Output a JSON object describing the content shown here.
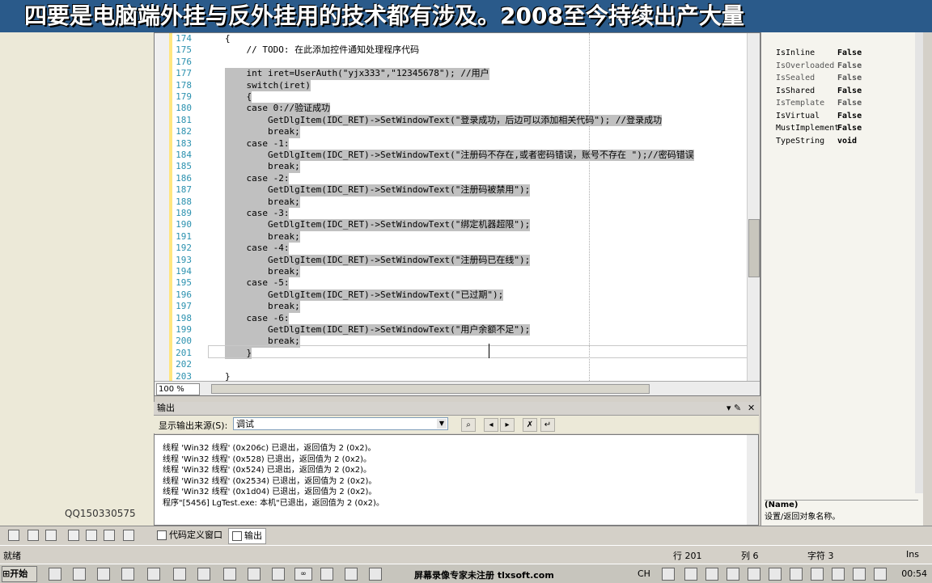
{
  "banner": {
    "text": "四要是电脑端外挂与反外挂用的技术都有涉及。2008至今持续出产大量"
  },
  "left_panel": {
    "qq": "QQ150330575"
  },
  "editor": {
    "zoom": "100 %",
    "lines": [
      {
        "n": "174",
        "code": "{",
        "sel": false
      },
      {
        "n": "175",
        "code": "    // TODO: 在此添加控件通知处理程序代码",
        "sel": false
      },
      {
        "n": "176",
        "code": "",
        "sel": false
      },
      {
        "n": "177",
        "code": "    int iret=UserAuth(\"yjx333\",\"12345678\"); //用户",
        "sel": true
      },
      {
        "n": "178",
        "code": "    switch(iret)",
        "sel": true
      },
      {
        "n": "179",
        "code": "    {",
        "sel": true
      },
      {
        "n": "180",
        "code": "    case 0://验证成功",
        "sel": true
      },
      {
        "n": "181",
        "code": "        GetDlgItem(IDC_RET)->SetWindowText(\"登录成功，后边可以添加相关代码\"); //登录成功",
        "sel": true
      },
      {
        "n": "182",
        "code": "        break;",
        "sel": true
      },
      {
        "n": "183",
        "code": "    case -1:",
        "sel": true
      },
      {
        "n": "184",
        "code": "        GetDlgItem(IDC_RET)->SetWindowText(\"注册码不存在,或者密码错误，账号不存在 \");//密码错误",
        "sel": true
      },
      {
        "n": "185",
        "code": "        break;",
        "sel": true
      },
      {
        "n": "186",
        "code": "    case -2:",
        "sel": true
      },
      {
        "n": "187",
        "code": "        GetDlgItem(IDC_RET)->SetWindowText(\"注册码被禁用\");",
        "sel": true
      },
      {
        "n": "188",
        "code": "        break;",
        "sel": true
      },
      {
        "n": "189",
        "code": "    case -3:",
        "sel": true
      },
      {
        "n": "190",
        "code": "        GetDlgItem(IDC_RET)->SetWindowText(\"绑定机器超限\");",
        "sel": true
      },
      {
        "n": "191",
        "code": "        break;",
        "sel": true
      },
      {
        "n": "192",
        "code": "    case -4:",
        "sel": true
      },
      {
        "n": "193",
        "code": "        GetDlgItem(IDC_RET)->SetWindowText(\"注册码已在线\");",
        "sel": true
      },
      {
        "n": "194",
        "code": "        break;",
        "sel": true
      },
      {
        "n": "195",
        "code": "    case -5:",
        "sel": true
      },
      {
        "n": "196",
        "code": "        GetDlgItem(IDC_RET)->SetWindowText(\"已过期\");",
        "sel": true
      },
      {
        "n": "197",
        "code": "        break;",
        "sel": true
      },
      {
        "n": "198",
        "code": "    case -6:",
        "sel": true
      },
      {
        "n": "199",
        "code": "        GetDlgItem(IDC_RET)->SetWindowText(\"用户余额不足\");",
        "sel": true
      },
      {
        "n": "200",
        "code": "        break;",
        "sel": true
      },
      {
        "n": "201",
        "code": "    }",
        "sel": true
      },
      {
        "n": "202",
        "code": "",
        "sel": false
      },
      {
        "n": "203",
        "code": "}",
        "sel": false
      }
    ]
  },
  "properties": {
    "rows": [
      {
        "name": "IsInline",
        "value": "False",
        "dim": false
      },
      {
        "name": "IsOverloaded",
        "value": "False",
        "dim": true
      },
      {
        "name": "IsSealed",
        "value": "False",
        "dim": true
      },
      {
        "name": "IsShared",
        "value": "False",
        "dim": false
      },
      {
        "name": "IsTemplate",
        "value": "False",
        "dim": true
      },
      {
        "name": "IsVirtual",
        "value": "False",
        "dim": false
      },
      {
        "name": "MustImplement",
        "value": "False",
        "dim": false
      },
      {
        "name": "TypeString",
        "value": "void",
        "dim": false
      }
    ],
    "desc_title": "(Name)",
    "desc_text": "设置/返回对象名称。"
  },
  "output": {
    "title": "输出",
    "source_label": "显示输出来源(S):",
    "source_value": "调试",
    "lines": [
      "线程 'Win32 线程' (0x206c) 已退出，返回值为 2 (0x2)。",
      "线程 'Win32 线程' (0x528) 已退出，返回值为 2 (0x2)。",
      "线程 'Win32 线程' (0x524) 已退出，返回值为 2 (0x2)。",
      "线程 'Win32 线程' (0x2534) 已退出，返回值为 2 (0x2)。",
      "线程 'Win32 线程' (0x1d04) 已退出，返回值为 2 (0x2)。",
      "程序\"[5456] LgTest.exe: 本机\"已退出，返回值为 2 (0x2)。"
    ]
  },
  "tabs": {
    "code_def": "代码定义窗口",
    "output": "输出"
  },
  "status": {
    "ready": "就绪",
    "line": "行 201",
    "col": "列 6",
    "char": "字符 3",
    "ins": "Ins"
  },
  "taskbar": {
    "start": "开始",
    "watermark": "屏幕录像专家未注册 tlxsoft.com",
    "ime": "CH",
    "clock": "00:54"
  }
}
